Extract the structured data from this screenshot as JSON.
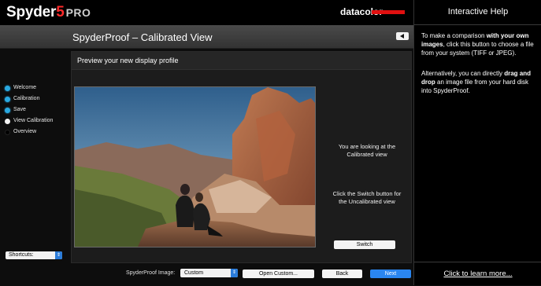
{
  "header": {
    "logo_text": "Spyder",
    "logo_number": "5",
    "logo_edition": "PRO",
    "brand": "datacolor",
    "brand_color": "#e01010"
  },
  "titlebar": {
    "title": "SpyderProof – Calibrated View",
    "back_icon": "left-triangle-icon"
  },
  "steps": [
    {
      "label": "Welcome",
      "state": "done"
    },
    {
      "label": "Calibration",
      "state": "done"
    },
    {
      "label": "Save",
      "state": "done"
    },
    {
      "label": "View Calibration",
      "state": "current"
    },
    {
      "label": "Overview",
      "state": "pending"
    }
  ],
  "shortcuts": {
    "label": "Shortcuts:"
  },
  "panel": {
    "heading": "Preview your new display profile",
    "message1_line1": "You are looking at the",
    "message1_line2": "Calibrated view",
    "message2_line1": "Click the Switch button for",
    "message2_line2": "the Uncalibrated view",
    "switch_label": "Switch"
  },
  "bottom": {
    "image_label": "SpyderProof Image:",
    "image_select_value": "Custom",
    "open_custom_label": "Open Custom...",
    "back_label": "Back",
    "next_label": "Next"
  },
  "help": {
    "title": "Interactive Help",
    "p1_a": "To make a comparison ",
    "p1_b": "with your own images",
    "p1_c": ", click this button to choose a file from your system (TIFF or JPEG).",
    "p2_a": "Alternatively, you can directly ",
    "p2_b": "drag and drop",
    "p2_c": " an image file from your hard disk into SpyderProof.",
    "footer_link": "Click to learn more..."
  },
  "colors": {
    "accent_blue": "#2a86f0",
    "step_done": "#29a9e1",
    "logo_red": "#ff2a2a"
  }
}
